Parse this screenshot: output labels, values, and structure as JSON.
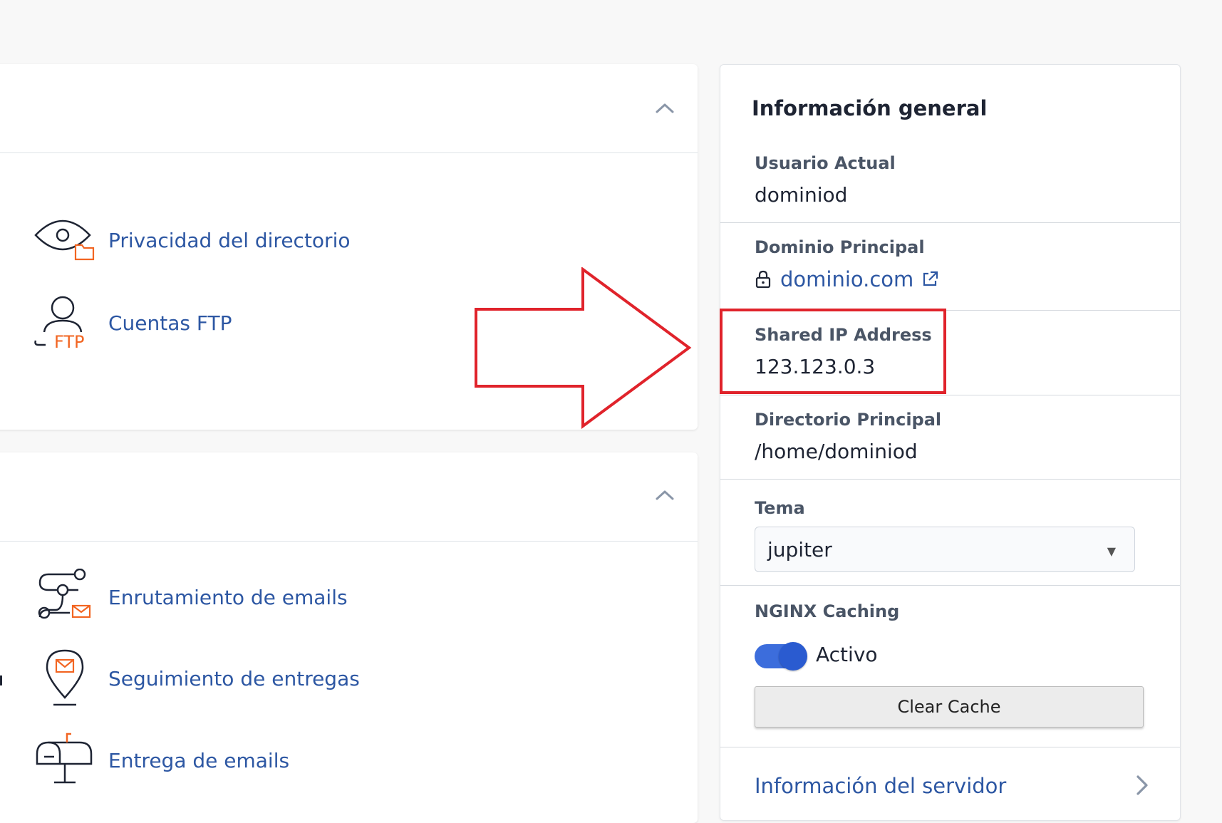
{
  "tools": {
    "files_section": [
      {
        "label": "Privacidad del directorio",
        "icon": "eye-folder-icon"
      },
      {
        "label": "Cuentas FTP",
        "icon": "user-ftp-icon"
      }
    ],
    "email_section": [
      {
        "label": "Enrutamiento de emails",
        "icon": "email-routing-icon"
      },
      {
        "label": "Seguimiento de entregas",
        "icon": "location-mail-icon"
      },
      {
        "label": "Entrega de emails",
        "icon": "mailbox-icon"
      }
    ],
    "ftp_icon_text": "FTP"
  },
  "general_info": {
    "title": "Información general",
    "current_user": {
      "label": "Usuario Actual",
      "value": "dominiod"
    },
    "primary_domain": {
      "label": "Dominio Principal",
      "value": "dominio.com"
    },
    "shared_ip": {
      "label": "Shared IP Address",
      "value": "123.123.0.3"
    },
    "home_directory": {
      "label": "Directorio Principal",
      "value": "/home/dominiod"
    },
    "theme": {
      "label": "Tema",
      "selected": "jupiter"
    },
    "nginx_caching": {
      "label": "NGINX Caching",
      "toggle_on": true,
      "status": "Activo"
    },
    "clear_cache_label": "Clear Cache",
    "server_info_link": "Información del servidor"
  },
  "colors": {
    "link": "#2d57a3",
    "icon_accent": "#f26522",
    "toggle": "#3c6ddc",
    "annotation": "#e0232b"
  }
}
